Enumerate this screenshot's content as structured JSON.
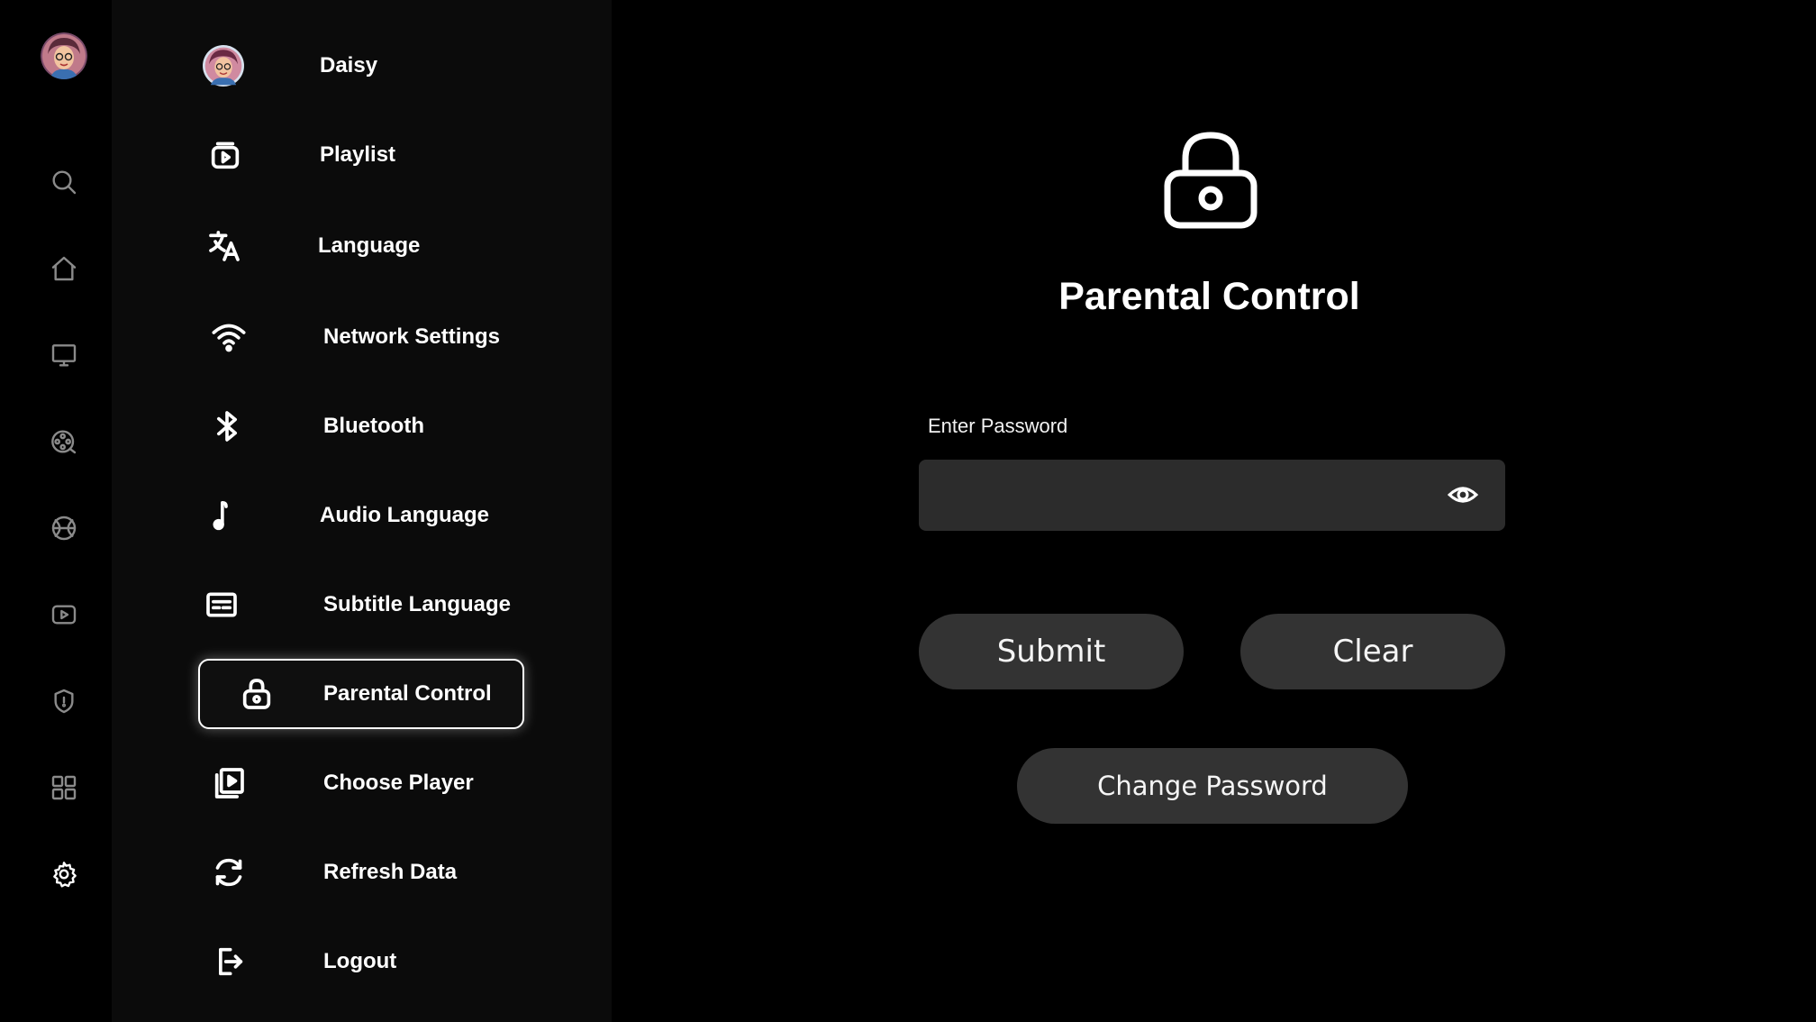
{
  "user": {
    "name": "Daisy"
  },
  "menu": {
    "items": [
      {
        "label": "Daisy"
      },
      {
        "label": "Playlist"
      },
      {
        "label": "Language"
      },
      {
        "label": "Network Settings"
      },
      {
        "label": "Bluetooth"
      },
      {
        "label": "Audio Language"
      },
      {
        "label": "Subtitle Language"
      },
      {
        "label": "Parental Control"
      },
      {
        "label": "Choose Player"
      },
      {
        "label": "Refresh Data"
      },
      {
        "label": "Logout"
      }
    ],
    "selected": "Parental Control"
  },
  "rail": {
    "icons": [
      "avatar",
      "search-icon",
      "home-icon",
      "tv-icon",
      "movies-icon",
      "sports-icon",
      "video-icon",
      "shield-icon",
      "grid-icon",
      "gear-icon"
    ],
    "active": "gear-icon"
  },
  "main": {
    "title": "Parental Control",
    "password_label": "Enter Password",
    "password_value": "",
    "submit_label": "Submit",
    "clear_label": "Clear",
    "change_password_label": "Change Password"
  },
  "colors": {
    "background": "#000000",
    "panel": "#0b0b0b",
    "input": "#2c2c2c",
    "button": "#333333",
    "icon_inactive": "#8a8a8a",
    "text": "#ffffff"
  }
}
